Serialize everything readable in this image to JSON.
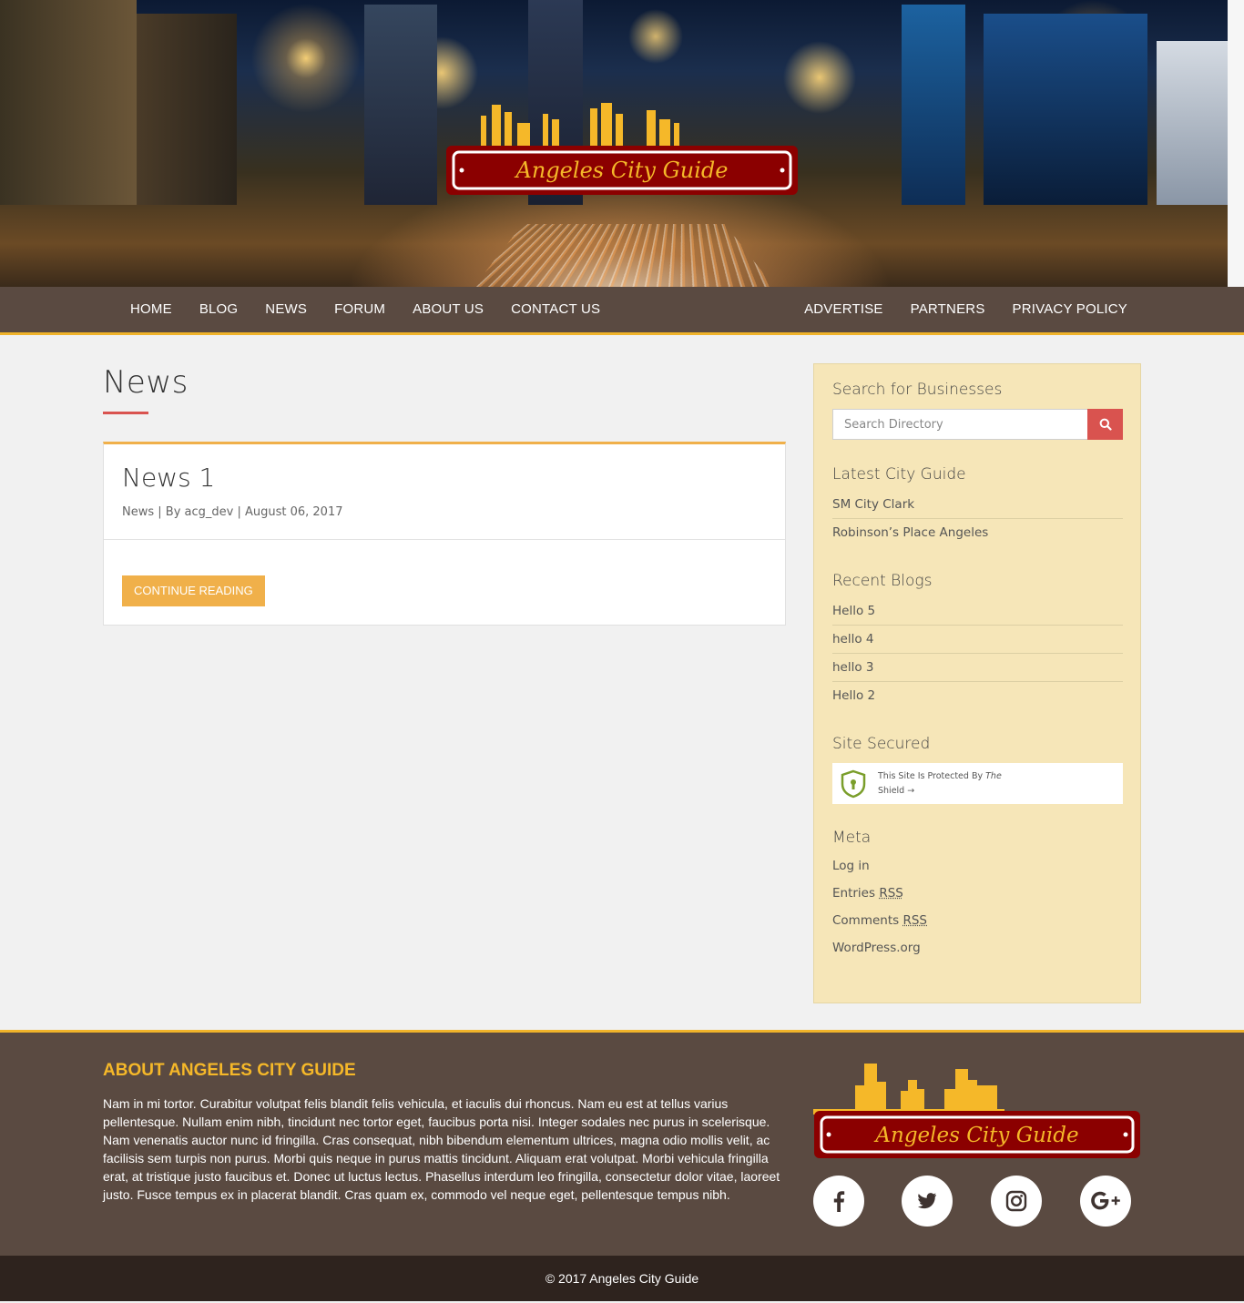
{
  "site": {
    "logo_text": "Angeles City Guide",
    "colors": {
      "nav_bg": "#5a4a41",
      "accent_yellow": "#f0b32a",
      "logo_red": "#8b0000",
      "button_orange": "#f0b04a",
      "search_red": "#d9534f",
      "sidebar_bg": "#f6e6b8"
    }
  },
  "nav": {
    "left": [
      "HOME",
      "BLOG",
      "NEWS",
      "FORUM",
      "ABOUT US",
      "CONTACT US"
    ],
    "right": [
      "ADVERTISE",
      "PARTNERS",
      "PRIVACY POLICY"
    ]
  },
  "main": {
    "page_title": "News",
    "posts": [
      {
        "title": "News 1",
        "meta": "News | By acg_dev | August 06, 2017",
        "button": "CONTINUE READING"
      }
    ]
  },
  "sidebar": {
    "search": {
      "title": "Search for Businesses",
      "placeholder": "Search Directory",
      "icon": "search-icon"
    },
    "latest_city_guide": {
      "title": "Latest City Guide",
      "items": [
        "SM City Clark",
        "Robinson’s Place Angeles"
      ]
    },
    "recent_blogs": {
      "title": "Recent Blogs",
      "items": [
        "Hello 5",
        "hello 4",
        "hello 3",
        "Hello 2"
      ]
    },
    "site_secured": {
      "title": "Site Secured",
      "line1": "This Site Is Protected By",
      "line1_italic": "The",
      "line2": "Shield →",
      "icon": "shield-icon"
    },
    "meta": {
      "title": "Meta",
      "log_in": "Log in",
      "entries_prefix": "Entries ",
      "entries_abbr": "RSS",
      "comments_prefix": "Comments ",
      "comments_abbr": "RSS",
      "wordpress": "WordPress.org"
    }
  },
  "footer": {
    "about_heading": "ABOUT ANGELES CITY GUIDE",
    "about_text": "Nam in mi tortor. Curabitur volutpat felis blandit felis vehicula, et iaculis dui rhoncus. Nam eu est at tellus varius pellentesque. Nullam enim nibh, tincidunt nec tortor eget, faucibus porta nisi. Integer sodales nec purus in scelerisque. Nam venenatis auctor nunc id fringilla. Cras consequat, nibh bibendum elementum ultrices, magna odio mollis velit, ac facilisis sem turpis non purus. Morbi quis neque in purus mattis tincidunt. Aliquam erat volutpat. Morbi vehicula fringilla erat, at tristique justo faucibus et. Donec ut luctus lectus. Phasellus interdum leo fringilla, consectetur dolor vitae, laoreet justo. Fusce tempus ex in placerat blandit. Cras quam ex, commodo vel neque eget, pellentesque tempus nibh.",
    "social": [
      "facebook-icon",
      "twitter-icon",
      "instagram-icon",
      "google-plus-icon"
    ],
    "copyright": "© 2017 Angeles City Guide"
  }
}
